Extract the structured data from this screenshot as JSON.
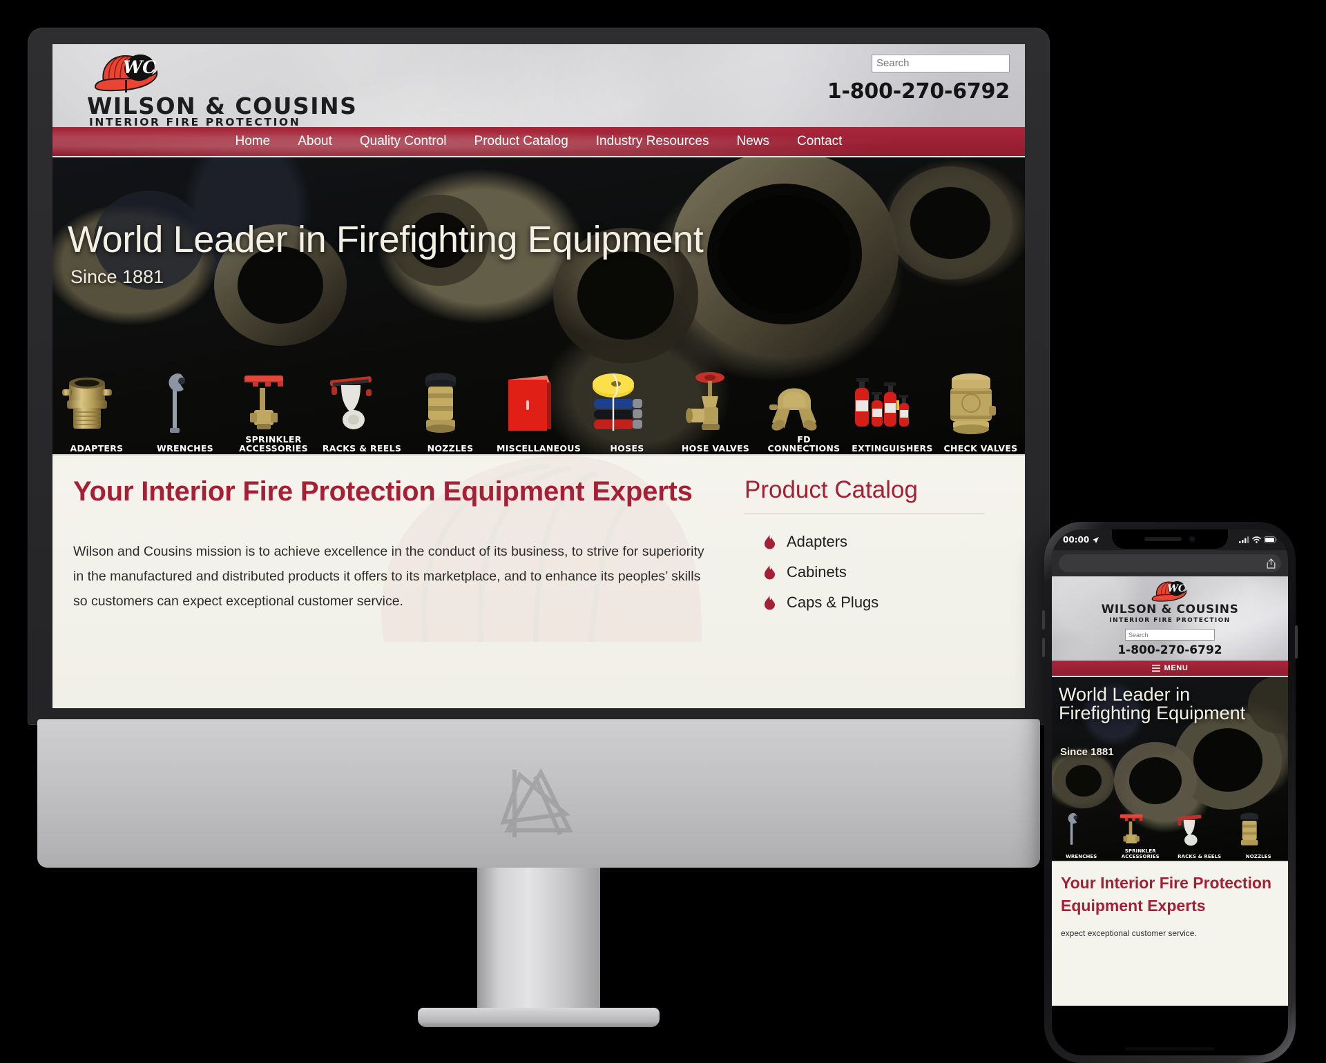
{
  "brand": {
    "name": "WILSON & COUSINS",
    "tagline": "INTERIOR FIRE PROTECTION",
    "monogram": "WC",
    "accent_red": "#a52035",
    "nav_red": "#9e2134",
    "helmet_red": "#e8402f"
  },
  "header": {
    "search_placeholder": "Search",
    "search_value": "",
    "phone": "1-800-270-6792"
  },
  "nav": {
    "items": [
      {
        "label": "Home"
      },
      {
        "label": "About"
      },
      {
        "label": "Quality Control"
      },
      {
        "label": "Product Catalog"
      },
      {
        "label": "Industry Resources"
      },
      {
        "label": "News"
      },
      {
        "label": "Contact"
      }
    ]
  },
  "hero": {
    "title": "World Leader in Firefighting Equipment",
    "subtitle": "Since 1881",
    "categories": [
      {
        "label": "ADAPTERS",
        "icon": "adapter-icon"
      },
      {
        "label": "WRENCHES",
        "icon": "wrench-icon"
      },
      {
        "label": "SPRINKLER ACCESSORIES",
        "icon": "sprinkler-valve-icon"
      },
      {
        "label": "RACKS & REELS",
        "icon": "rack-reel-icon"
      },
      {
        "label": "NOZZLES",
        "icon": "nozzle-icon"
      },
      {
        "label": "MISCELLANEOUS",
        "icon": "cabinet-icon"
      },
      {
        "label": "HOSES",
        "icon": "hose-coil-icon"
      },
      {
        "label": "HOSE VALVES",
        "icon": "hose-valve-icon"
      },
      {
        "label": "FD CONNECTIONS",
        "icon": "fd-connection-icon"
      },
      {
        "label": "EXTINGUISHERS",
        "icon": "extinguisher-icon"
      },
      {
        "label": "CHECK VALVES",
        "icon": "check-valve-icon"
      }
    ]
  },
  "main": {
    "heading": "Your Interior Fire Protection Equipment Experts",
    "body": "Wilson and Cousins mission is to achieve excellence in the conduct of its business, to strive for superiority in the manufactured and distributed products it offers to its marketplace, and to enhance its peoples’ skills so customers can expect exceptional customer service."
  },
  "sidebar": {
    "heading": "Product Catalog",
    "items": [
      {
        "label": "Adapters"
      },
      {
        "label": "Cabinets"
      },
      {
        "label": "Caps & Plugs"
      }
    ]
  },
  "mobile": {
    "status": {
      "time": "00:00",
      "location_icon": "location-arrow-icon",
      "signal_icon": "cellular-signal-icon",
      "wifi_icon": "wifi-icon",
      "battery_icon": "battery-icon"
    },
    "browser": {
      "url": "",
      "share_icon": "share-icon"
    },
    "menu_label": "MENU",
    "menu_icon": "hamburger-icon",
    "search_placeholder": "Search",
    "phone": "1-800-270-6792",
    "hero_title": "World Leader in Firefighting Equipment",
    "hero_subtitle": "Since 1881",
    "categories": [
      {
        "label": "WRENCHES"
      },
      {
        "label": "SPRINKLER ACCESSORIES"
      },
      {
        "label": "RACKS & REELS"
      },
      {
        "label": "NOZZLES"
      }
    ],
    "heading": "Your Interior Fire Protection Equipment Experts",
    "body": "expect exceptional customer service."
  }
}
